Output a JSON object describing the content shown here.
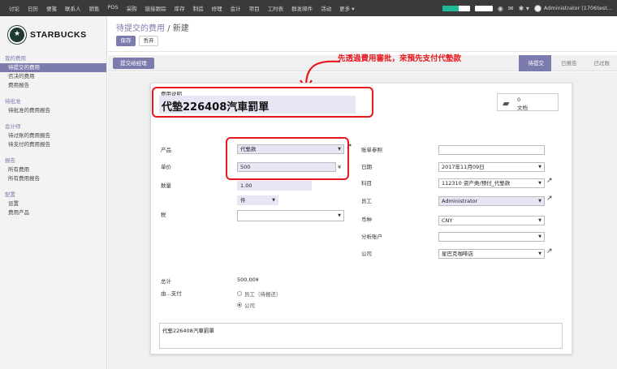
{
  "topbar": {
    "menu": [
      "讨论",
      "日历",
      "便笺",
      "联系人",
      "销售",
      "POS",
      "采购",
      "链接跟踪",
      "库存",
      "制造",
      "修理",
      "会计",
      "项目",
      "工时表",
      "群发邮件",
      "活动",
      "更多 ▾"
    ],
    "progress_percent": 60,
    "user": "Administrator (1706test...",
    "icons": [
      "camera-icon",
      "chat-icon",
      "gear-icon"
    ]
  },
  "sidebar": {
    "brand": "STARBUCKS",
    "sections": [
      {
        "title": "我的费用",
        "items": [
          "待提交的费用",
          "否决的费用",
          "费用报告"
        ]
      },
      {
        "title": "待批准",
        "items": [
          "待批准的费用报告"
        ]
      },
      {
        "title": "会计师",
        "items": [
          "待过账的费用报告",
          "待支付的费用报告"
        ]
      },
      {
        "title": "报告",
        "items": [
          "所有费用",
          "所有费用报告"
        ]
      },
      {
        "title": "配置",
        "items": [
          "设置",
          "费用产品"
        ]
      }
    ],
    "active_item": "待提交的费用"
  },
  "main": {
    "breadcrumb_parent": "待提交的费用",
    "breadcrumb_sep": "/",
    "breadcrumb_current": "新建",
    "save_label": "保存",
    "discard_label": "丢弃",
    "submit_label": "提交给经理",
    "stages": [
      "待提交",
      "已报告",
      "已过账"
    ],
    "active_stage": "待提交",
    "annotation": "先透過費用審批，來預先支付代墊款"
  },
  "form": {
    "desc_label": "费用说明",
    "desc_value": "代墊226408汽車罰單",
    "doc_count": "0",
    "doc_label": "文档",
    "product_label": "产品",
    "product_value": "代墊款",
    "unit_price_label": "单价",
    "unit_price_value": "500",
    "currency_symbol": "¥",
    "quantity_label": "数量",
    "quantity_value": "1.00",
    "uom_value": "件",
    "tax_label": "税",
    "tax_value": "",
    "bill_ref_label": "账单参照",
    "bill_ref_value": "",
    "date_label": "日期",
    "date_value": "2017年11月09日",
    "account_label": "科目",
    "account_value": "112310 资产类/预付_代墊款",
    "employee_label": "员工",
    "employee_value": "Administrator",
    "currency_label": "币种",
    "currency_value": "CNY",
    "analytic_label": "分析账户",
    "analytic_value": "",
    "company_label": "公司",
    "company_value": "星巴克咖啡店",
    "total_label": "总计",
    "total_value": "500.00¥",
    "paid_by_label": "由...支付",
    "paid_by_options": [
      "员工（待报还）",
      "公司"
    ],
    "paid_by_selected": "公司",
    "notes_value": "代墊226408汽車罰單"
  }
}
